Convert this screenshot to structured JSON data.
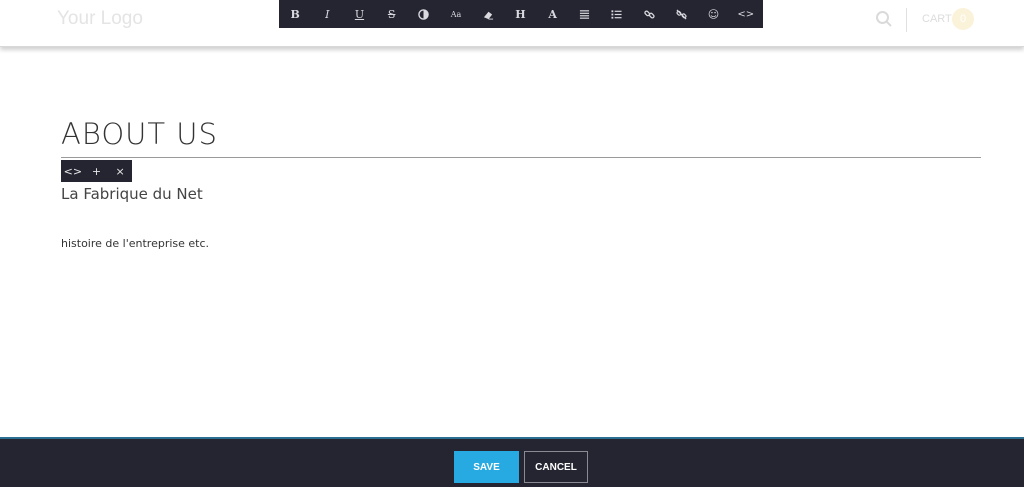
{
  "header": {
    "logo": "Your Logo",
    "cart_label": "CART",
    "cart_count": "0"
  },
  "toolbar": {
    "buttons": [
      {
        "icon": "bold-icon",
        "glyph": "B"
      },
      {
        "icon": "italic-icon",
        "glyph": "I"
      },
      {
        "icon": "underline-icon",
        "glyph": "U"
      },
      {
        "icon": "strikethrough-icon",
        "glyph": "S"
      },
      {
        "icon": "color-icon",
        "glyph": ""
      },
      {
        "icon": "font-size-icon",
        "glyph": "Aa"
      },
      {
        "icon": "eraser-icon",
        "glyph": ""
      },
      {
        "icon": "heading-icon",
        "glyph": "H"
      },
      {
        "icon": "text-color-icon",
        "glyph": "A"
      },
      {
        "icon": "align-icon",
        "glyph": ""
      },
      {
        "icon": "list-icon",
        "glyph": ""
      },
      {
        "icon": "link-icon",
        "glyph": ""
      },
      {
        "icon": "unlink-icon",
        "glyph": ""
      },
      {
        "icon": "emoji-icon",
        "glyph": "☺"
      },
      {
        "icon": "code-icon",
        "glyph": "<>"
      }
    ]
  },
  "block_toolbar": {
    "code": "<>",
    "add": "+",
    "remove": "×"
  },
  "main": {
    "title": "ABOUT US",
    "subtitle": "La Fabrique du Net",
    "body": "histoire de l'entreprise etc."
  },
  "footer": {
    "save": "SAVE",
    "cancel": "CANCEL"
  },
  "colors": {
    "toolbar_bg": "#252532",
    "save_bg": "#27aae1",
    "cart_badge": "#fbf2da"
  }
}
